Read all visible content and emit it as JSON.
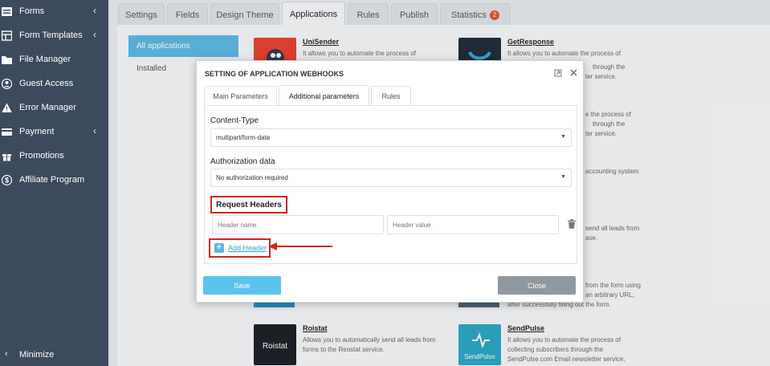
{
  "sidebar": {
    "items": [
      {
        "label": "Forms",
        "icon": "list-icon",
        "chevron": "‹"
      },
      {
        "label": "Form Templates",
        "icon": "template-icon",
        "chevron": "‹"
      },
      {
        "label": "File Manager",
        "icon": "folder-icon",
        "chevron": ""
      },
      {
        "label": "Guest Access",
        "icon": "user-circle-icon",
        "chevron": ""
      },
      {
        "label": "Error Manager",
        "icon": "warning-icon",
        "chevron": ""
      },
      {
        "label": "Payment",
        "icon": "card-icon",
        "chevron": "‹"
      },
      {
        "label": "Promotions",
        "icon": "gift-icon",
        "chevron": ""
      },
      {
        "label": "Affiliate Program",
        "icon": "dollar-icon",
        "chevron": ""
      }
    ],
    "minimize_label": "Minimize",
    "minimize_chevron": "‹"
  },
  "tabs": [
    {
      "label": "Settings"
    },
    {
      "label": "Fields"
    },
    {
      "label": "Design Theme"
    },
    {
      "label": "Applications"
    },
    {
      "label": "Rules"
    },
    {
      "label": "Publish"
    },
    {
      "label": "Statistics",
      "badge": "2"
    }
  ],
  "side_menu": {
    "all": "All applications",
    "installed": "Installed"
  },
  "apps": {
    "unisender": {
      "name": "UniSender",
      "desc": "It allows you to automate the process of"
    },
    "getresponse": {
      "name": "GetResponse",
      "desc": "It allows you to automate the process of"
    },
    "roistat": {
      "name": "Roistat",
      "desc": "Allows you to automatically send all leads from forms to the Reostat service.",
      "logo_text": "Roistat"
    },
    "sendpulse": {
      "name": "SendPulse",
      "desc": "It allows you to automate the process of collecting subscribers through the SendPulse.com Email newsletter service.",
      "logo_text": "SendPulse"
    }
  },
  "background_fragments": {
    "f1": "through the",
    "f2": "ter service.",
    "f3": "e the process of",
    "f4": "through the",
    "f5": "ter service.",
    "f6": "accounting system",
    "f7": "send all leads from",
    "f8": "ase.",
    "f9": "from the form using",
    "f10": "an arbitrary URL,",
    "f11": "after successfully filling out the form."
  },
  "modal": {
    "title": "SETTING OF APPLICATION WEBHOOKS",
    "tabs": [
      "Main Parameters",
      "Additional parameters",
      "Rules"
    ],
    "content_type_label": "Content-Type",
    "content_type_value": "multipart/form-data",
    "auth_label": "Authorization data",
    "auth_value": "No authorization required",
    "request_headers_label": "Request Headers",
    "header_name_placeholder": "Header name",
    "header_value_placeholder": "Header value",
    "add_header_label": "Add Header",
    "save_label": "Save",
    "close_label": "Close"
  },
  "colors": {
    "sidebar_bg": "#3c4a5e",
    "accent": "#5bb8e3",
    "highlight": "#d0261e",
    "badge": "#e6512e"
  }
}
